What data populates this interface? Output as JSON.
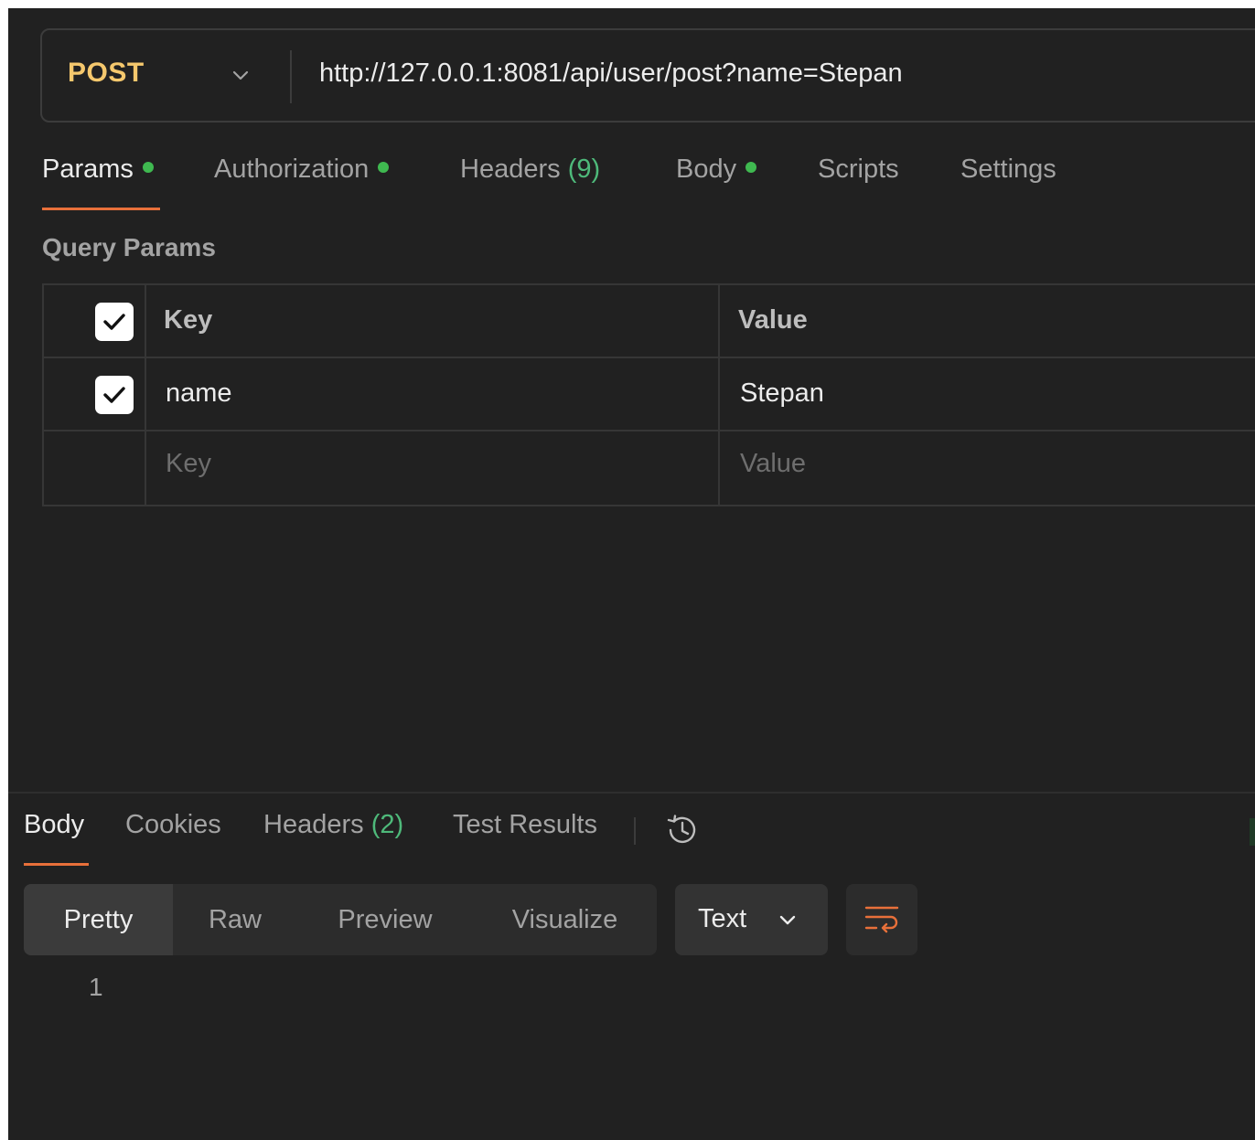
{
  "request": {
    "method": "POST",
    "url": "http://127.0.0.1:8081/api/user/post?name=Stepan"
  },
  "request_tabs": [
    {
      "label": "Params",
      "indicator": "dot",
      "active": true
    },
    {
      "label": "Authorization",
      "indicator": "dot",
      "active": false
    },
    {
      "label": "Headers",
      "count": "(9)",
      "active": false
    },
    {
      "label": "Body",
      "indicator": "dot",
      "active": false
    },
    {
      "label": "Scripts",
      "active": false
    },
    {
      "label": "Settings",
      "active": false
    }
  ],
  "query_params": {
    "title": "Query Params",
    "headers": {
      "key": "Key",
      "value": "Value"
    },
    "rows": [
      {
        "checked": true,
        "key": "name",
        "value": "Stepan"
      }
    ],
    "placeholder": {
      "key": "Key",
      "value": "Value"
    }
  },
  "response_tabs": [
    {
      "label": "Body",
      "active": true
    },
    {
      "label": "Cookies",
      "active": false
    },
    {
      "label": "Headers",
      "count": "(2)",
      "active": false
    },
    {
      "label": "Test Results",
      "active": false
    }
  ],
  "response_format": {
    "modes": [
      "Pretty",
      "Raw",
      "Preview",
      "Visualize"
    ],
    "active_mode": "Pretty",
    "type_select": "Text"
  },
  "editor": {
    "line_numbers": [
      "1"
    ]
  },
  "icons": {
    "method_dropdown": "chevron-down-icon",
    "checkbox": "checkmark-icon",
    "history": "history-icon",
    "type_dropdown": "chevron-down-icon",
    "wrap": "wrap-lines-icon"
  },
  "colors": {
    "method": "#f5c86d",
    "accent": "#e8703a",
    "indicator": "#3fb950",
    "count": "#4eb97a",
    "background": "#212121"
  }
}
